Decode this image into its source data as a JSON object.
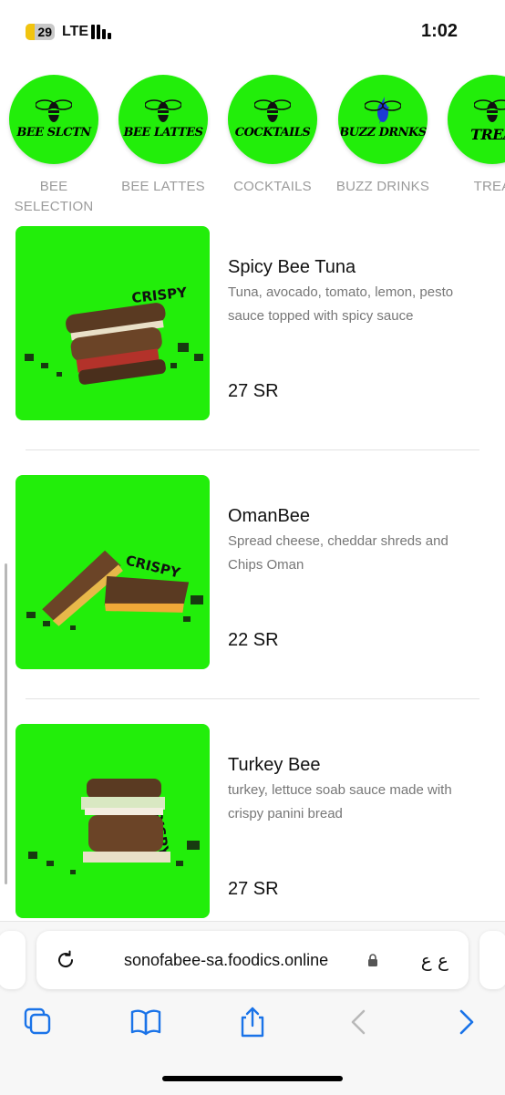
{
  "status": {
    "battery": "29",
    "battery_level": 0.29,
    "network": "LTE",
    "time": "1:02"
  },
  "categories": [
    {
      "logo_text": "BEE SLCTN",
      "label": "BEE SELECTION",
      "icon": "bee-icon"
    },
    {
      "logo_text": "BEE LATTES",
      "label": "BEE LATTES",
      "icon": "bee-icon"
    },
    {
      "logo_text": "COCKTAILS",
      "label": "COCKTAILS",
      "icon": "bee-icon"
    },
    {
      "logo_text": "BUZZ DRNKS",
      "label": "BUZZ DRINKS",
      "icon": "lightning-bee-icon"
    },
    {
      "logo_text": "TREA",
      "label": "TREA",
      "icon": "bee-icon"
    }
  ],
  "products": [
    {
      "name": "Spicy Bee Tuna",
      "description": "Tuna, avocado, tomato, lemon, pesto sauce topped with spicy sauce",
      "price": "27 SR",
      "image_text": "CRISPY"
    },
    {
      "name": "OmanBee",
      "description": "Spread cheese, cheddar shreds and Chips Oman",
      "price": "22 SR",
      "image_text": "CRISPY"
    },
    {
      "name": "Turkey Bee",
      "description": "turkey, lettuce soab sauce made with crispy panini bread",
      "price": "27 SR",
      "image_text": "CRISPY"
    }
  ],
  "browser": {
    "url": "sonofabee-sa.foodics.online",
    "lang_button": "ع ع",
    "icons": [
      "reload-icon",
      "lock-icon",
      "tabs-icon",
      "bookmarks-icon",
      "share-icon",
      "back-icon",
      "forward-icon"
    ]
  },
  "colors": {
    "brand_green": "#22ee0a",
    "link_blue": "#1a73e8"
  }
}
